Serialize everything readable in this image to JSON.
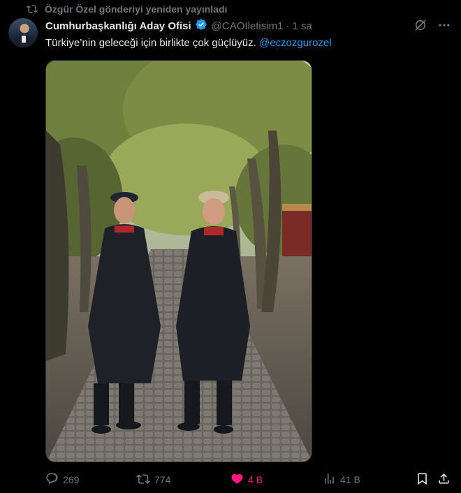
{
  "repost": {
    "icon": "repost-icon",
    "label": "Özgür Özel gönderiyi yeniden yayınladı"
  },
  "author": {
    "display_name": "Cumhurbaşkanlığı Aday Ofisi",
    "handle": "@CAOIletisim1",
    "separator": "·",
    "time": "1 sa",
    "verified_color": "#1d9bf0"
  },
  "tweet": {
    "text": "Türkiye’nin geleceği için birlikte çok güçlüyüz.",
    "mention": "@eczozgurozel"
  },
  "media": {
    "type": "photo",
    "alt": "Two men in black raincoats and rubber boots standing on a tree-lined cobblestone path"
  },
  "stats": {
    "replies": "269",
    "reposts": "774",
    "likes": "4 B",
    "views": "41 B"
  },
  "colors": {
    "background": "#000000",
    "text": "#e7e9ea",
    "muted": "#71767b",
    "link": "#1d9bf0",
    "like": "#f91880"
  }
}
